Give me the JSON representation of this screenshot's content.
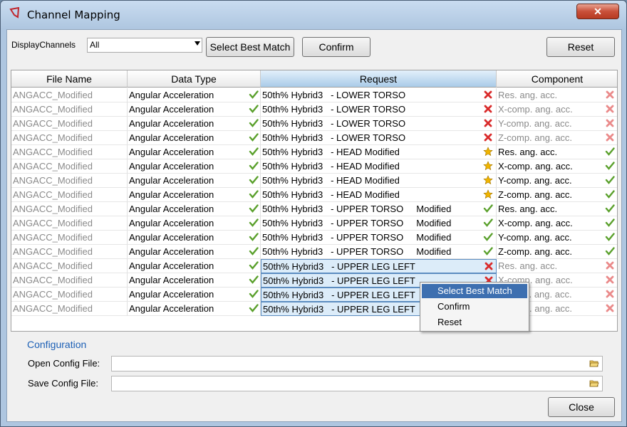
{
  "window": {
    "title": "Channel Mapping"
  },
  "toolbar": {
    "display_label": "DisplayChannels",
    "display_value": "All",
    "select_best_label": "Select Best Match",
    "confirm_label": "Confirm",
    "reset_label": "Reset"
  },
  "grid": {
    "columns": [
      "File Name",
      "Data Type",
      "Request",
      "Component"
    ],
    "rows": [
      {
        "file": "ANGACC_Modified",
        "type": "Angular Acceleration",
        "type_icon": "check-icon",
        "request": "50th% Hybrid3   - LOWER TORSO",
        "req_icon": "cross-icon",
        "component": "Res. ang. acc.",
        "comp_icon": "cross-icon",
        "comp_grey": true
      },
      {
        "file": "ANGACC_Modified",
        "type": "Angular Acceleration",
        "type_icon": "check-icon",
        "request": "50th% Hybrid3   - LOWER TORSO",
        "req_icon": "cross-icon",
        "component": "X-comp. ang. acc.",
        "comp_icon": "cross-icon",
        "comp_grey": true
      },
      {
        "file": "ANGACC_Modified",
        "type": "Angular Acceleration",
        "type_icon": "check-icon",
        "request": "50th% Hybrid3   - LOWER TORSO",
        "req_icon": "cross-icon",
        "component": "Y-comp. ang. acc.",
        "comp_icon": "cross-icon",
        "comp_grey": true
      },
      {
        "file": "ANGACC_Modified",
        "type": "Angular Acceleration",
        "type_icon": "check-icon",
        "request": "50th% Hybrid3   - LOWER TORSO",
        "req_icon": "cross-icon",
        "component": "Z-comp. ang. acc.",
        "comp_icon": "cross-icon",
        "comp_grey": true
      },
      {
        "file": "ANGACC_Modified",
        "type": "Angular Acceleration",
        "type_icon": "check-icon",
        "request": "50th% Hybrid3   - HEAD Modified",
        "req_icon": "star-icon",
        "component": "Res. ang. acc.",
        "comp_icon": "check-icon",
        "comp_grey": false
      },
      {
        "file": "ANGACC_Modified",
        "type": "Angular Acceleration",
        "type_icon": "check-icon",
        "request": "50th% Hybrid3   - HEAD Modified",
        "req_icon": "star-icon",
        "component": "X-comp. ang. acc.",
        "comp_icon": "check-icon",
        "comp_grey": false
      },
      {
        "file": "ANGACC_Modified",
        "type": "Angular Acceleration",
        "type_icon": "check-icon",
        "request": "50th% Hybrid3   - HEAD Modified",
        "req_icon": "star-icon",
        "component": "Y-comp. ang. acc.",
        "comp_icon": "check-icon",
        "comp_grey": false
      },
      {
        "file": "ANGACC_Modified",
        "type": "Angular Acceleration",
        "type_icon": "check-icon",
        "request": "50th% Hybrid3   - HEAD Modified",
        "req_icon": "star-icon",
        "component": "Z-comp. ang. acc.",
        "comp_icon": "check-icon",
        "comp_grey": false
      },
      {
        "file": "ANGACC_Modified",
        "type": "Angular Acceleration",
        "type_icon": "check-icon",
        "request": "50th% Hybrid3   - UPPER TORSO     Modified",
        "req_icon": "check-icon",
        "component": "Res. ang. acc.",
        "comp_icon": "check-icon",
        "comp_grey": false
      },
      {
        "file": "ANGACC_Modified",
        "type": "Angular Acceleration",
        "type_icon": "check-icon",
        "request": "50th% Hybrid3   - UPPER TORSO     Modified",
        "req_icon": "check-icon",
        "component": "X-comp. ang. acc.",
        "comp_icon": "check-icon",
        "comp_grey": false
      },
      {
        "file": "ANGACC_Modified",
        "type": "Angular Acceleration",
        "type_icon": "check-icon",
        "request": "50th% Hybrid3   - UPPER TORSO     Modified",
        "req_icon": "check-icon",
        "component": "Y-comp. ang. acc.",
        "comp_icon": "check-icon",
        "comp_grey": false
      },
      {
        "file": "ANGACC_Modified",
        "type": "Angular Acceleration",
        "type_icon": "check-icon",
        "request": "50th% Hybrid3   - UPPER TORSO     Modified",
        "req_icon": "check-icon",
        "component": "Z-comp. ang. acc.",
        "comp_icon": "check-icon",
        "comp_grey": false
      },
      {
        "file": "ANGACC_Modified",
        "type": "Angular Acceleration",
        "type_icon": "check-icon",
        "request": "50th% Hybrid3   - UPPER LEG LEFT",
        "req_icon": "cross-icon",
        "component": "Res. ang. acc.",
        "comp_icon": "cross-icon",
        "comp_grey": true,
        "selected": true
      },
      {
        "file": "ANGACC_Modified",
        "type": "Angular Acceleration",
        "type_icon": "check-icon",
        "request": "50th% Hybrid3   - UPPER LEG LEFT",
        "req_icon": "cross-icon",
        "component": "X-comp. ang. acc.",
        "comp_icon": "cross-icon",
        "comp_grey": true,
        "selected": true
      },
      {
        "file": "ANGACC_Modified",
        "type": "Angular Acceleration",
        "type_icon": "check-icon",
        "request": "50th% Hybrid3   - UPPER LEG LEFT",
        "req_icon": "cross-icon",
        "component": "Y-comp. ang. acc.",
        "comp_icon": "cross-icon",
        "comp_grey": true,
        "selected": true
      },
      {
        "file": "ANGACC_Modified",
        "type": "Angular Acceleration",
        "type_icon": "check-icon",
        "request": "50th% Hybrid3   - UPPER LEG LEFT",
        "req_icon": "cross-icon",
        "component": "Z-comp. ang. acc.",
        "comp_icon": "cross-icon",
        "comp_grey": true,
        "selected": true
      }
    ]
  },
  "config": {
    "title": "Configuration",
    "open_label": "Open Config File:",
    "open_value": "",
    "save_label": "Save Config File:",
    "save_value": ""
  },
  "context_menu": {
    "items": [
      "Select Best Match",
      "Confirm",
      "Reset"
    ]
  },
  "footer": {
    "close_label": "Close"
  },
  "colors": {
    "accent": "#3d6fb0",
    "check": "#5aa02c",
    "cross": "#d92b2b",
    "star": "#f0b400"
  }
}
